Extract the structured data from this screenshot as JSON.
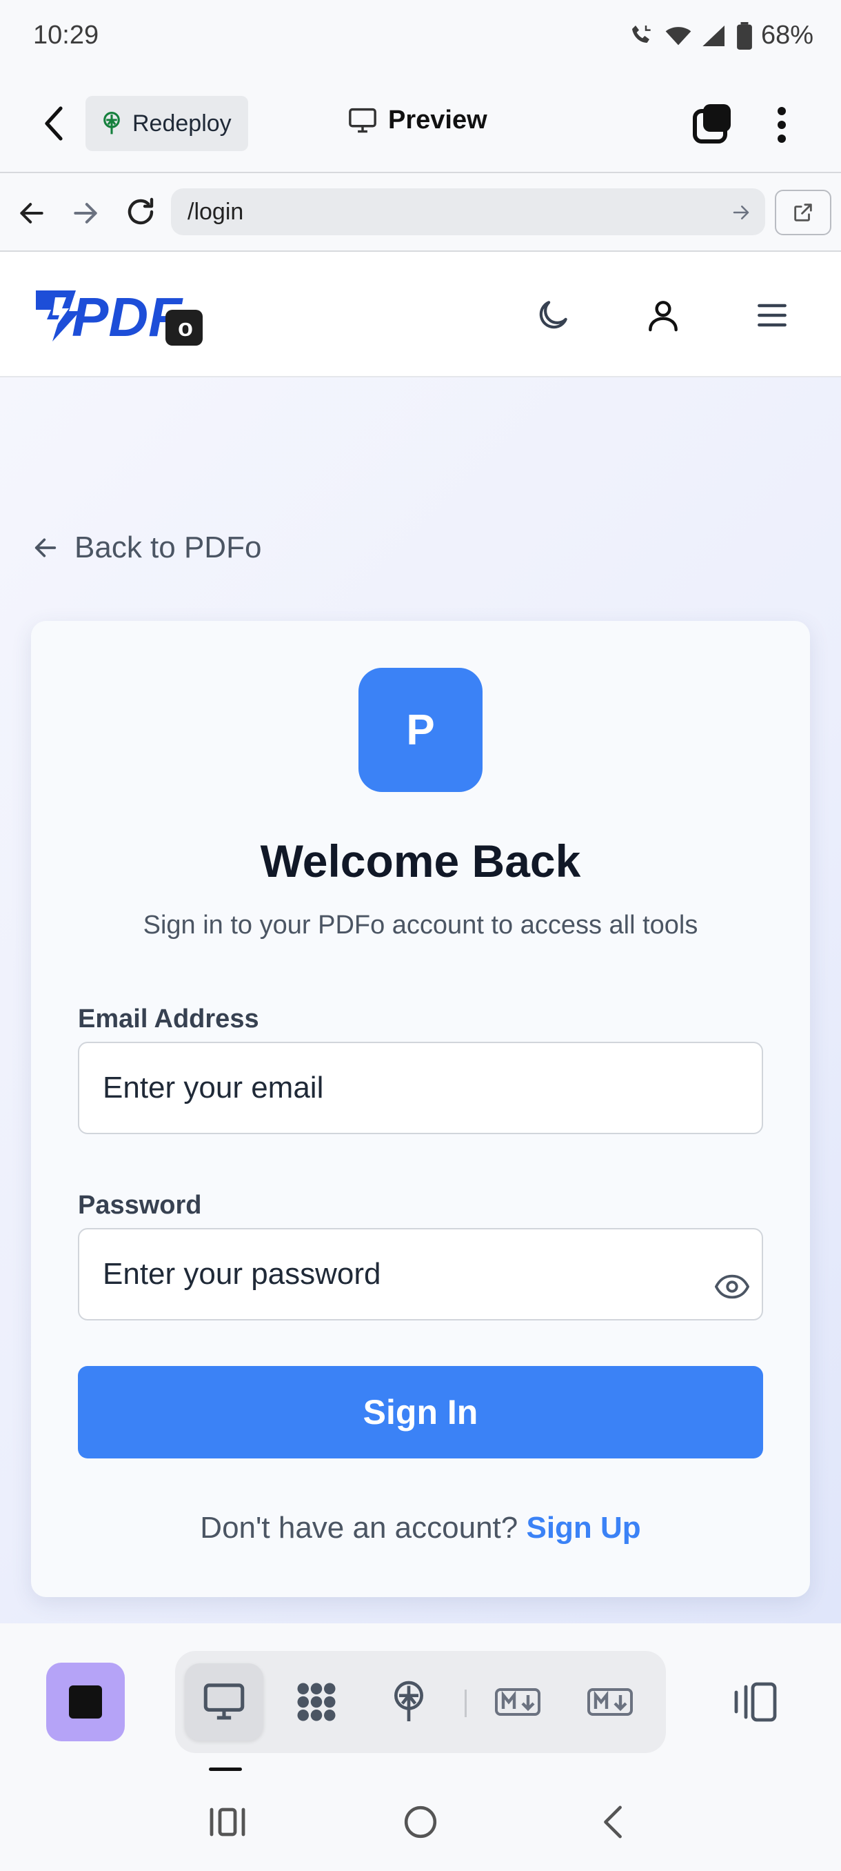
{
  "status_bar": {
    "time": "10:29",
    "battery": "68%"
  },
  "app_toolbar": {
    "redeploy_label": "Redeploy",
    "preview_label": "Preview"
  },
  "browser": {
    "url": "/login"
  },
  "site_header": {
    "logo_text": "PDF",
    "logo_badge": "o"
  },
  "page": {
    "back_link": "Back to PDFo"
  },
  "login_card": {
    "badge_letter": "P",
    "title": "Welcome Back",
    "subtitle": "Sign in to your PDFo account to access all tools",
    "email_label": "Email Address",
    "email_placeholder": "Enter your email",
    "password_label": "Password",
    "password_placeholder": "Enter your password",
    "submit_label": "Sign In",
    "signup_prompt": "Don't have an account?",
    "signup_link": "Sign Up"
  },
  "colors": {
    "accent": "#3b82f6",
    "app_tile": "#b5a3f7",
    "logo_blue": "#1d4ed8"
  },
  "dock": {
    "items": [
      "monitor-icon",
      "apps-grid-icon",
      "deploy-tree-icon",
      "markdown-icon",
      "markdown-icon"
    ],
    "active_index": 0
  }
}
